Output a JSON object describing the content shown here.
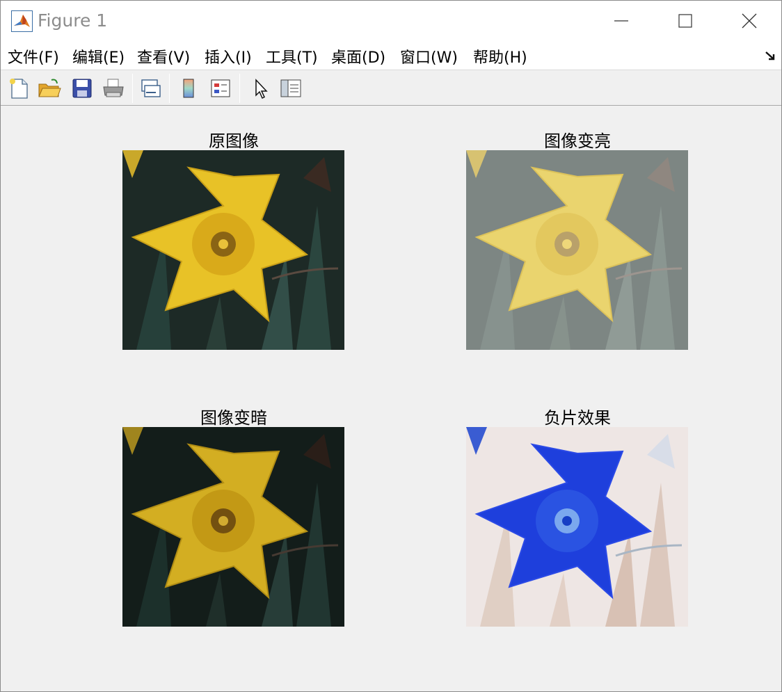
{
  "window": {
    "title": "Figure 1",
    "controls": {
      "minimize": "minimize",
      "maximize": "maximize",
      "close": "close"
    }
  },
  "menu": {
    "items": [
      {
        "label": "文件(F)"
      },
      {
        "label": "编辑(E)"
      },
      {
        "label": "查看(V)"
      },
      {
        "label": "插入(I)"
      },
      {
        "label": "工具(T)"
      },
      {
        "label": "桌面(D)"
      },
      {
        "label": "窗口(W)"
      },
      {
        "label": "帮助(H)"
      }
    ]
  },
  "toolbar": {
    "icons": [
      "new-figure-icon",
      "open-file-icon",
      "save-figure-icon",
      "print-figure-icon",
      "link-plot-icon",
      "insert-colorbar-icon",
      "insert-legend-icon",
      "edit-plot-icon",
      "property-inspector-icon"
    ]
  },
  "axes": [
    {
      "title": "原图像",
      "variant": "original"
    },
    {
      "title": "图像变亮",
      "variant": "brighter"
    },
    {
      "title": "图像变暗",
      "variant": "darker"
    },
    {
      "title": "负片效果",
      "variant": "negative"
    }
  ],
  "colors": {
    "petal_original": "#e8c227",
    "background_original": "#1d2a26",
    "petal_negative": "#1e3fdc",
    "background_negative": "#eee6e4"
  }
}
